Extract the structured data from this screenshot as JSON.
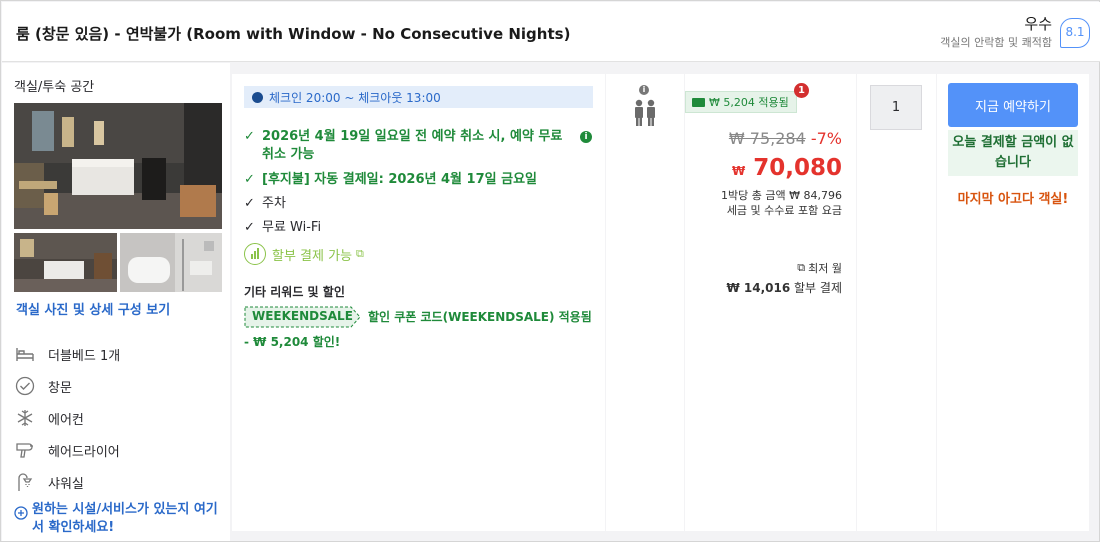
{
  "header": {
    "room_title": "룸 (창문 있음) - 연박불가 (Room with Window - No Consecutive Nights)",
    "rating_word": "우수",
    "rating_sub": "객실의 안락함 및 쾌적함",
    "rating_score": "8.1"
  },
  "left": {
    "title": "객실/투숙 공간",
    "photo_link": "객실 사진 및 상세 구성 보기",
    "amenities": [
      {
        "label": "더블베드 1개",
        "icon": "bed-icon"
      },
      {
        "label": "창문",
        "icon": "window-check-icon"
      },
      {
        "label": "에어컨",
        "icon": "snowflake-icon"
      },
      {
        "label": "헤어드라이어",
        "icon": "hairdryer-icon"
      },
      {
        "label": "샤워실",
        "icon": "shower-icon"
      }
    ],
    "more_link": "원하는 시설/서비스가 있는지 여기서 확인하세요!"
  },
  "middle": {
    "checkin_text": "체크인 20:00 ~ 체크아웃 13:00",
    "features": [
      {
        "text": "2026년 4월 19일 일요일 전 예약 취소 시, 예약 무료 취소 가능",
        "style": "green"
      },
      {
        "text": "[후지불] 자동 결제일: 2026년 4월 17일 금요일",
        "style": "green"
      },
      {
        "text": "주차",
        "style": "plain"
      },
      {
        "text": "무료 Wi-Fi",
        "style": "plain"
      }
    ],
    "installment": "할부 결제 가능",
    "other_title": "기타 리워드 및 할인",
    "coupon_code": "WEEKENDSALE",
    "coupon_text": "할인 쿠폰 코드(WEEKENDSALE) 적용됨",
    "coupon_text2": "- ₩ 5,204 할인!"
  },
  "price": {
    "saving_badge": "₩ 5,204 적용됨",
    "notification_count": "1",
    "original_price": "₩ 75,284",
    "discount": "-7%",
    "currency": "₩",
    "final_price": "70,080",
    "per_night_line": "1박당 총 금액 ₩ 84,796",
    "tax_line": "세금 및 수수료 포함 요금",
    "monthly_label": "최저 월",
    "monthly_amount": "₩ 14,016",
    "monthly_suffix": "할부 결제"
  },
  "quantity": {
    "value": "1"
  },
  "booking": {
    "book_button": "지금 예약하기",
    "pay_note": "오늘 결제할 금액이 없습니다",
    "last_room": "마지막 아고다 객실!"
  },
  "colors": {
    "accent_blue": "#5392f9",
    "link_blue": "#2a69c9",
    "price_red": "#e4332d",
    "green": "#1f8a3a",
    "orange": "#d8540f"
  }
}
